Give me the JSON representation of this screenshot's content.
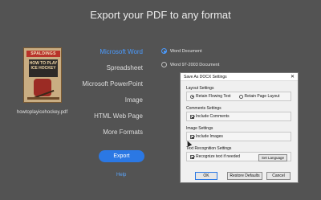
{
  "header": {
    "title": "Export your PDF to any format"
  },
  "file": {
    "thumbnail_lines": [
      "SPALDINGS",
      "HOW TO PLAY ICE HOCKEY"
    ],
    "name": "howtoplayicehockey.pdf"
  },
  "formats": [
    {
      "label": "Microsoft Word",
      "active": true
    },
    {
      "label": "Spreadsheet",
      "active": false
    },
    {
      "label": "Microsoft PowerPoint",
      "active": false
    },
    {
      "label": "Image",
      "active": false
    },
    {
      "label": "HTML Web Page",
      "active": false
    },
    {
      "label": "More Formats",
      "active": false
    }
  ],
  "word_options": [
    {
      "label": "Word Document",
      "selected": true
    },
    {
      "label": "Word 97-2003 Document",
      "selected": false
    }
  ],
  "export_button": "Export",
  "help_link": "Help",
  "dialog": {
    "title": "Save As DOCX Settings",
    "close_icon": "close-icon",
    "layout": {
      "label": "Layout Settings",
      "options": [
        "Retain Flowing Text",
        "Retain Page Layout"
      ],
      "selected": "Retain Flowing Text"
    },
    "comments": {
      "label": "Comments Settings",
      "checkbox": "Include Comments",
      "checked": true
    },
    "images": {
      "label": "Image Settings",
      "checkbox": "Include Images",
      "checked": true
    },
    "ocr": {
      "label": "Text Recognition Settings",
      "checkbox": "Recognize text if needed",
      "checked": true,
      "button": "Set Language"
    },
    "buttons": {
      "ok": "OK",
      "restore": "Restore Defaults",
      "cancel": "Cancel"
    }
  },
  "colors": {
    "background": "#535353",
    "accent": "#2b78e4",
    "active_text": "#4a9bff"
  }
}
